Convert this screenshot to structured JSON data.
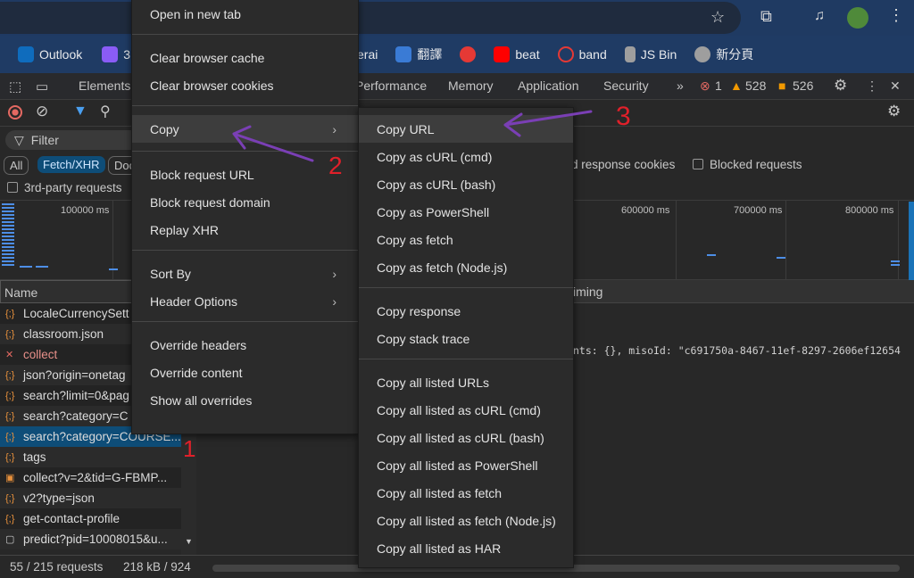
{
  "browser": {
    "bookmarks": [
      {
        "label": "Outlook",
        "color": "#0f6cbd"
      },
      {
        "label": "3",
        "color": "#8a5cf6"
      },
      {
        "label": "erai",
        "color": "#666"
      },
      {
        "label": "翻譯",
        "color": "#3a7bd5"
      },
      {
        "label": "",
        "color": "#e53935"
      },
      {
        "label": "beat",
        "color": "#ff0000"
      },
      {
        "label": "band",
        "color": "#e53935"
      },
      {
        "label": "JS Bin",
        "color": "#9e9e9e"
      },
      {
        "label": "新分頁",
        "color": "#9e9e9e"
      }
    ]
  },
  "devtools": {
    "tabs": [
      "Elements",
      "Performance",
      "Memory",
      "Application",
      "Security"
    ],
    "errors": "1",
    "warnings": "528",
    "issues": "526",
    "filter_placeholder": "Filter",
    "type_chips": [
      "All",
      "Fetch/XHR",
      "Doc"
    ],
    "third_party": "3rd-party requests",
    "response_cookies": "d response cookies",
    "blocked_requests": "Blocked requests",
    "ticks": [
      "100000 ms",
      "600000 ms",
      "700000 ms",
      "800000 ms"
    ],
    "name_header": "Name",
    "timing_tab": "iming",
    "preview_text": "nts: {}, misoId: \"c691750a-8467-11ef-8297-2606ef12654",
    "requests": [
      {
        "name": "LocaleCurrencySett",
        "type": "xhr"
      },
      {
        "name": "classroom.json",
        "type": "xhr"
      },
      {
        "name": "collect",
        "type": "error"
      },
      {
        "name": "json?origin=onetag",
        "type": "xhr"
      },
      {
        "name": "search?limit=0&pag",
        "type": "xhr"
      },
      {
        "name": "search?category=C",
        "type": "xhr"
      },
      {
        "name": "search?category=COURSE...",
        "type": "xhr",
        "selected": true
      },
      {
        "name": "tags",
        "type": "xhr"
      },
      {
        "name": "collect?v=2&tid=G-FBMP...",
        "type": "script"
      },
      {
        "name": "v2?type=json",
        "type": "xhr"
      },
      {
        "name": "get-contact-profile",
        "type": "xhr"
      },
      {
        "name": "predict?pid=10008015&u...",
        "type": "doc"
      }
    ],
    "status_requests": "55 / 215 requests",
    "status_size": "218 kB / 924"
  },
  "context_menu": {
    "items": [
      "Open in new tab",
      "Clear browser cache",
      "Clear browser cookies",
      "Copy",
      "Block request URL",
      "Block request domain",
      "Replay XHR",
      "Sort By",
      "Header Options",
      "Override headers",
      "Override content",
      "Show all overrides"
    ]
  },
  "copy_submenu": {
    "items": [
      "Copy URL",
      "Copy as cURL (cmd)",
      "Copy as cURL (bash)",
      "Copy as PowerShell",
      "Copy as fetch",
      "Copy as fetch (Node.js)",
      "Copy response",
      "Copy stack trace",
      "Copy all listed URLs",
      "Copy all listed as cURL (cmd)",
      "Copy all listed as cURL (bash)",
      "Copy all listed as PowerShell",
      "Copy all listed as fetch",
      "Copy all listed as fetch (Node.js)",
      "Copy all listed as HAR"
    ]
  },
  "annotations": [
    "1",
    "2",
    "3"
  ]
}
